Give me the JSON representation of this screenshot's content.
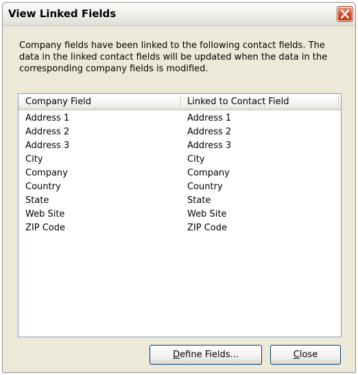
{
  "window": {
    "title": "View Linked Fields"
  },
  "description": "Company fields have been linked to the following contact fields. The data in the linked contact fields will be updated when the data in the corresponding company fields is modified.",
  "list": {
    "columns": [
      "Company Field",
      "Linked to Contact Field"
    ],
    "rows": [
      [
        "Address 1",
        "Address 1"
      ],
      [
        "Address 2",
        "Address 2"
      ],
      [
        "Address 3",
        "Address 3"
      ],
      [
        "City",
        "City"
      ],
      [
        "Company",
        "Company"
      ],
      [
        "Country",
        "Country"
      ],
      [
        "State",
        "State"
      ],
      [
        "Web Site",
        "Web Site"
      ],
      [
        "ZIP Code",
        "ZIP Code"
      ]
    ]
  },
  "buttons": {
    "define": {
      "mnemonic": "D",
      "rest": "efine Fields..."
    },
    "close": {
      "mnemonic": "C",
      "rest": "lose"
    }
  },
  "icons": {
    "close": "close-x-icon"
  },
  "colors": {
    "window_bg": "#ece9d8",
    "close_button": "#d2542d",
    "list_border": "#7f9db9"
  }
}
